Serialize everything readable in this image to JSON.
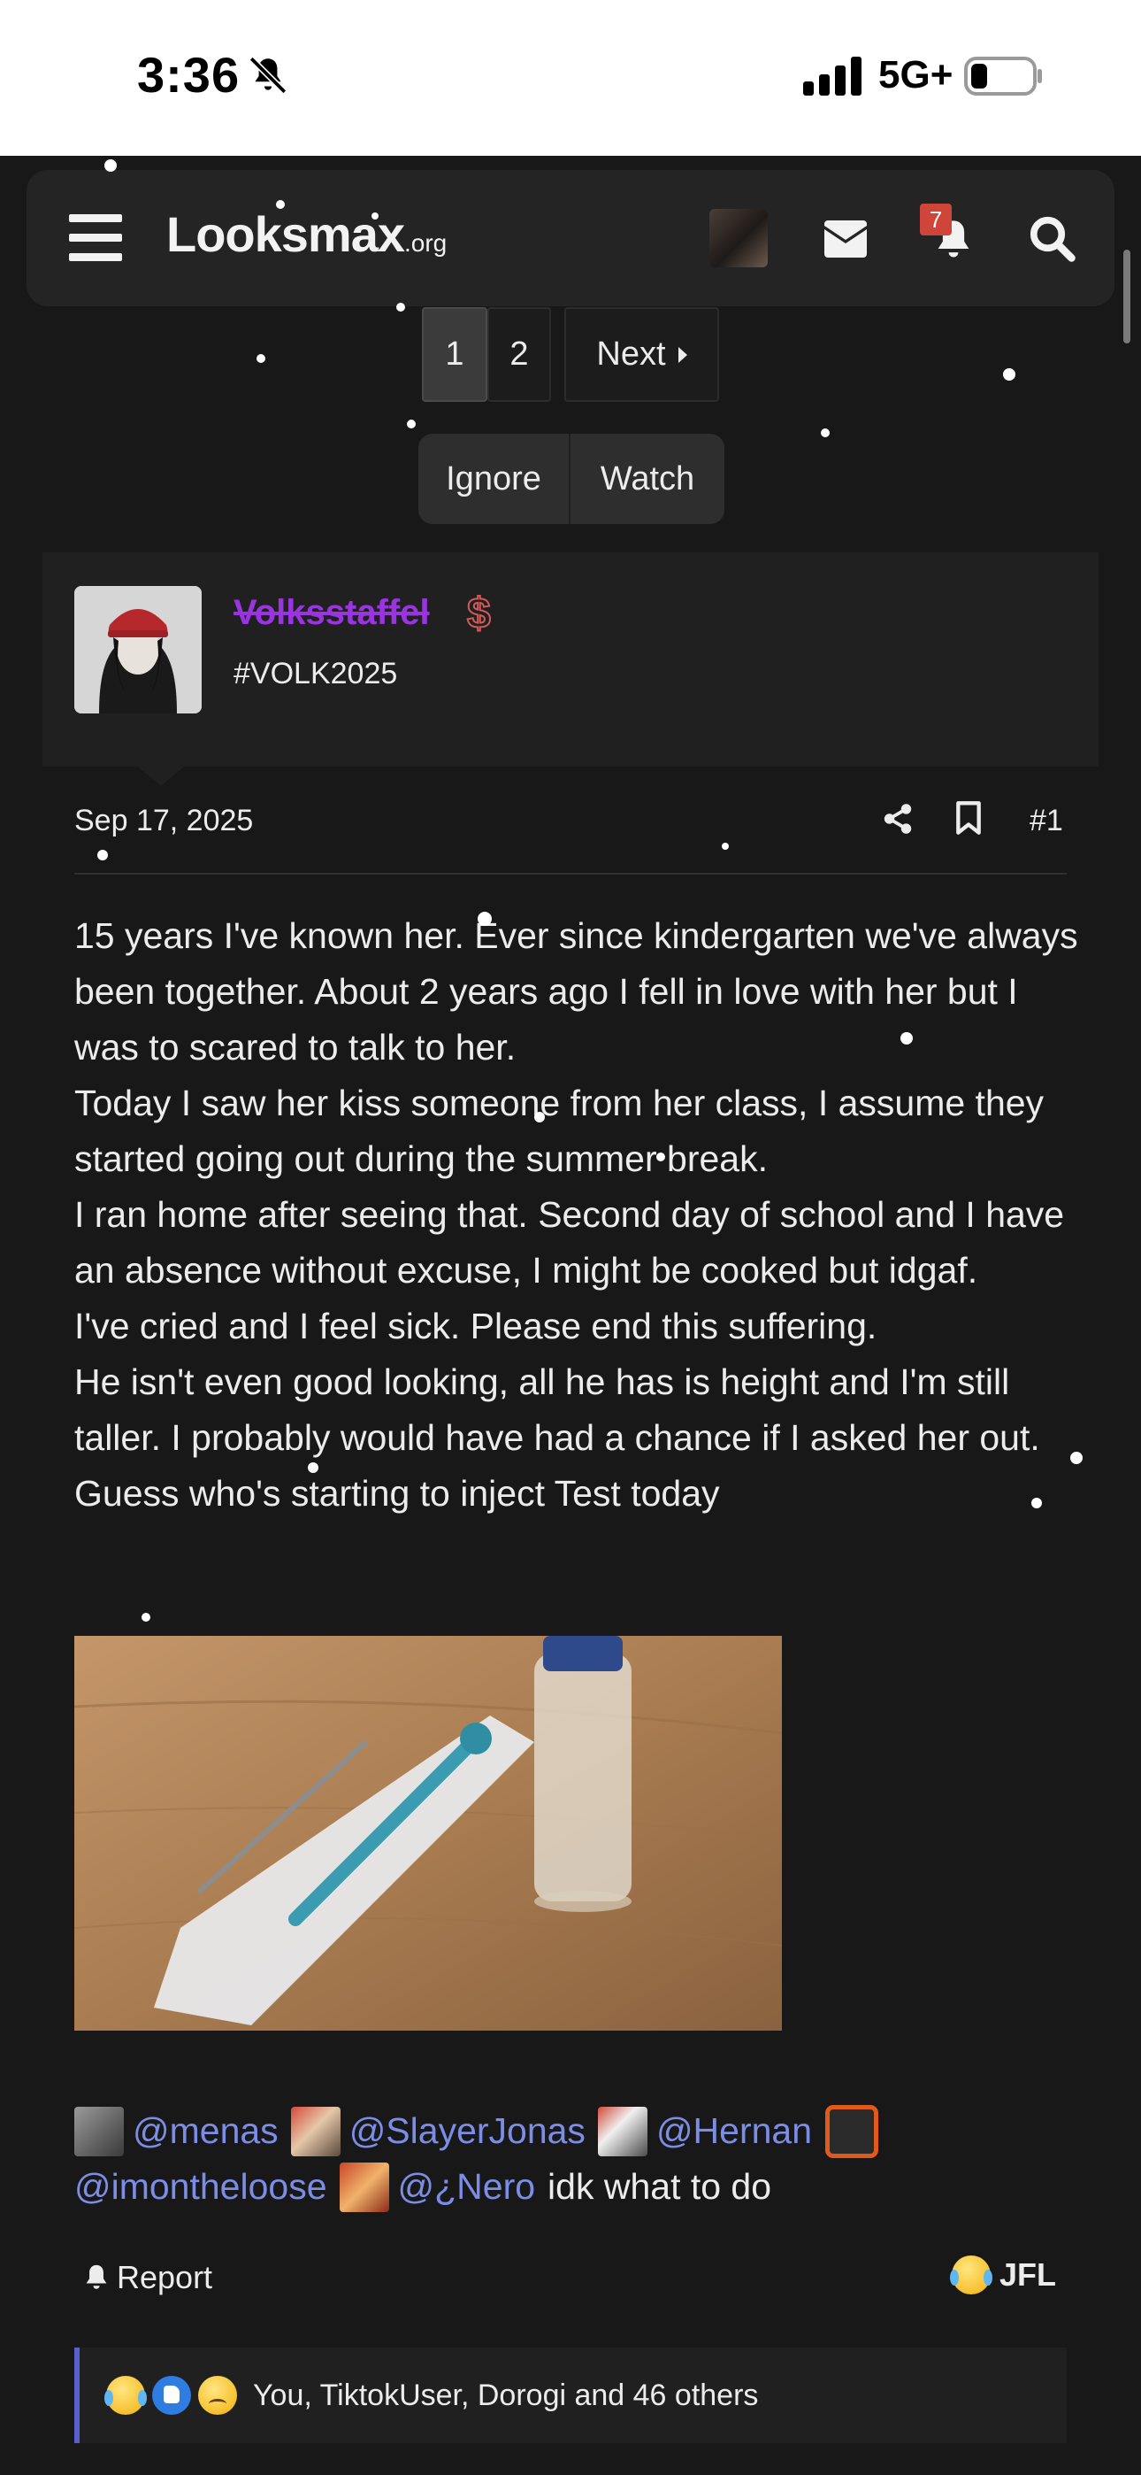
{
  "status_bar": {
    "time": "3:36",
    "network": "5G+",
    "icons": [
      "bell-off-icon",
      "signal-icon",
      "battery-icon"
    ]
  },
  "nav": {
    "logo_main": "Lοoksmax",
    "logo_suffix": ".org",
    "alerts_count": "7",
    "icons": [
      "hamburger-menu-icon",
      "mail-icon",
      "bell-icon",
      "search-icon"
    ]
  },
  "pagination": {
    "pages": [
      "1",
      "2"
    ],
    "current_page": "1",
    "next_label": "Next"
  },
  "thread_actions": {
    "ignore_label": "Ignore",
    "watch_label": "Watch"
  },
  "post": {
    "author": {
      "username": "Volksstaffel",
      "title": "#VOLK2025",
      "badge_icon": "dollar-icon"
    },
    "date": "Sep 17, 2025",
    "number": "#1",
    "body": [
      "15 years I've known her. Ever since kindergarten we've always been together. About 2 years ago I fell in love with her but I was to scared to talk to her.",
      "Today I saw her kiss someone from her class, I assume they started going out during the summer break.",
      "I ran home after seeing that. Second day of school and I have an absence without excuse, I might be cooked but idgaf.",
      "I've cried and I feel sick. Please end this suffering.",
      "He isn't even good looking, all he has is height and I'm still taller. I probably would have had a chance if I asked her out.",
      "Guess who's starting to inject Test today"
    ],
    "mentions": {
      "users": [
        "@menas",
        "@SlayerJonas",
        "@Hernan",
        "@imontheloose",
        "@¿Nero"
      ],
      "tail_text": "idk what to do"
    },
    "report_label": "Report",
    "reaction_label": "JFL",
    "reactions_summary": "You, TiktokUser, Dorogi and 46 others"
  },
  "colors": {
    "background": "#181818",
    "panel": "#202020",
    "nav": "#242424",
    "username": "#9a34e0",
    "mention": "#7c8de6",
    "accent_bar": "#5a5fd0",
    "badge": "#d0453a"
  }
}
